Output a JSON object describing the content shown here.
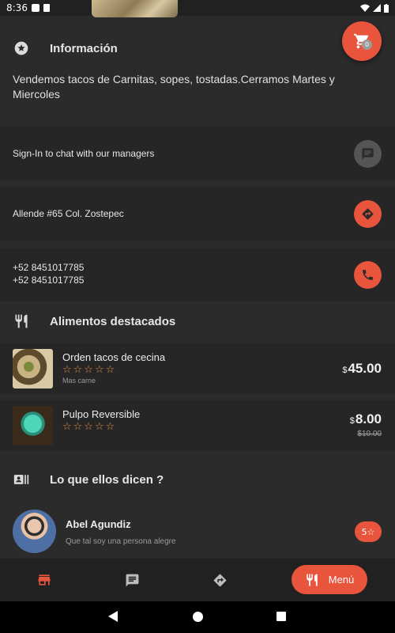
{
  "status_bar": {
    "time": "8:36"
  },
  "cart": {
    "count": "0"
  },
  "info": {
    "title": "Información",
    "text": "Vendemos tacos de Carnitas, sopes, tostadas.Cerramos Martes y Miercoles"
  },
  "chat_card": {
    "text": "Sign-In to chat with our managers"
  },
  "address_card": {
    "text": "Allende #65 Col. Zostepec"
  },
  "phone_card": {
    "phone1": "+52 8451017785",
    "phone2": "+52 8451017785"
  },
  "featured": {
    "title": "Alimentos destacados",
    "items": [
      {
        "name": "Orden tacos de cecina",
        "stars": "☆☆☆☆☆",
        "desc": "Mas carne",
        "currency": "$",
        "price": "45.00"
      },
      {
        "name": "Pulpo Reversible",
        "stars": "☆☆☆☆☆",
        "currency": "$",
        "price": "8.00",
        "old_price": "$10.00"
      }
    ]
  },
  "reviews": {
    "title": "Lo que ellos dicen ?",
    "items": [
      {
        "name": "Abel Agundiz",
        "text": "Que tal soy una persona alegre",
        "rating": "5☆"
      }
    ]
  },
  "bottom_nav": {
    "menu_label": "Menú"
  },
  "colors": {
    "accent": "#e8543c",
    "background": "#2b2b2b",
    "card": "#262626",
    "star": "#e8913c"
  }
}
